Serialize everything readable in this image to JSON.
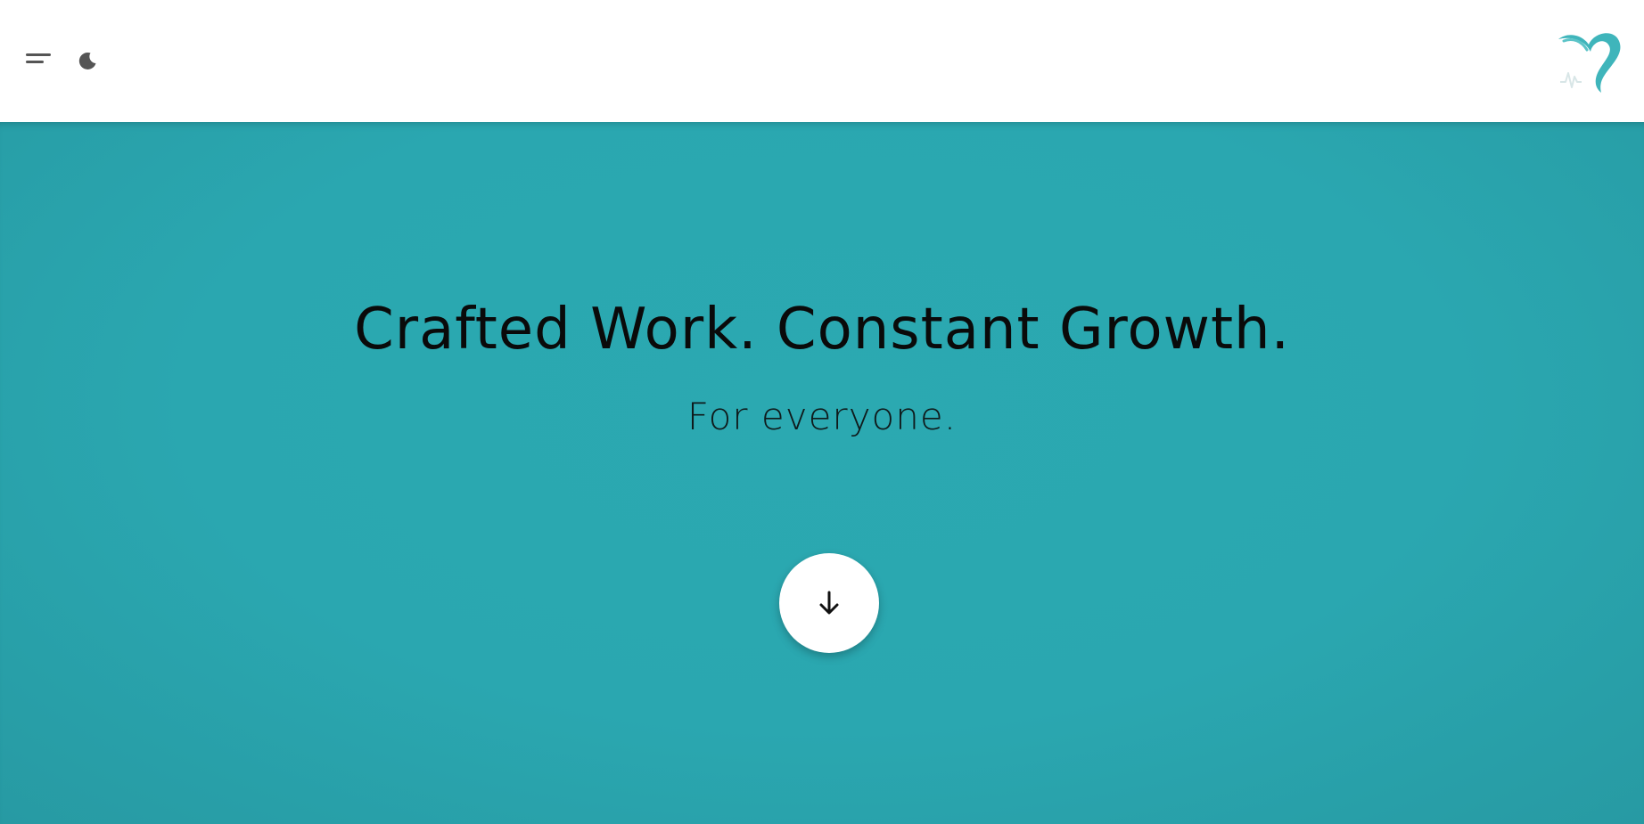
{
  "header": {
    "menu_icon": "hamburger-menu-icon",
    "theme_icon": "moon-icon",
    "logo_icon": "heart-question-logo"
  },
  "hero": {
    "title": "Crafted Work. Constant Growth.",
    "subtitle": "For everyone.",
    "scroll_icon": "arrow-down-icon"
  },
  "colors": {
    "hero_background": "#2aa7b0",
    "logo_primary": "#3fb5bb",
    "logo_secondary": "#5cc4c8",
    "icon_gray": "#555555",
    "text_dark": "#0a0a0a"
  }
}
